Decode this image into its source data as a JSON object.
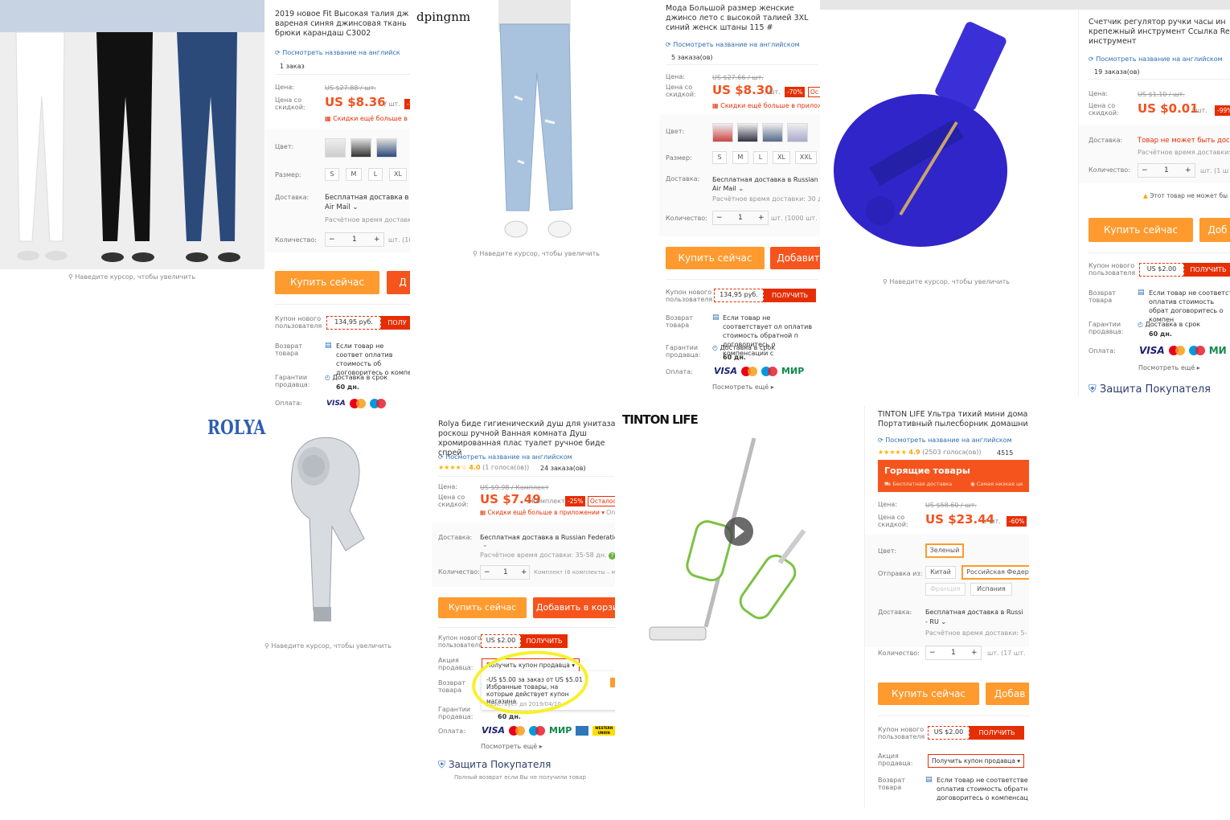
{
  "p1": {
    "title": "2019 новое Fit Высокая талия дж вареная синяя джинсовая ткань брюки карандаш С3002",
    "english_link": "Посмотреть название на английск",
    "orders": "1 заказ",
    "price_label": "Цена:",
    "old_price": "US $27.88 / шт.",
    "discount_label": "Цена со скидкой:",
    "price": "US $8.36",
    "unit": "/ шт.",
    "discount": "-7",
    "app_discount": "Скидки ещё больше в",
    "color_label": "Цвет:",
    "size_label": "Размер:",
    "sizes": [
      "S",
      "M",
      "L",
      "XL"
    ],
    "delivery_label": "Доставка:",
    "delivery": "Бесплатная доставка в I",
    "delivery_method": "Air Mail",
    "delivery_time": "Расчётное время доставк",
    "qty_label": "Количество:",
    "qty": "1",
    "qty_note": "шт. (10",
    "buy": "Купить сейчас",
    "cart": "Д",
    "coupon_label": "Купон нового пользователя",
    "coupon_value": "134,95 руб.",
    "coupon_get": "ПОЛУ",
    "return_label": "Возврат товара",
    "return_text": "Если товар не соответ оплатив стоимость об договоритесь о компе",
    "guarantee_label": "Гарантии продавца:",
    "guarantee_text": "Доставка в срок",
    "guarantee_days": "60 дн.",
    "payment_label": "Оплата:",
    "visa": "VISA",
    "zoom_hint": "Наведите курсор, чтобы увеличить"
  },
  "p2": {
    "brand": "dpingnm",
    "zoom_hint": "Наведите курсор, чтобы увеличить"
  },
  "p3": {
    "title": "Мода Большой размер женские джинсо лето с высокой талией 3XL синий женск штаны 115 #",
    "english_link": "Посмотреть название на английском",
    "orders": "5 заказа(ов)",
    "price_label": "Цена:",
    "old_price": "US $27.66 / шт.",
    "discount_label": "Цена со скидкой:",
    "price": "US $8.30",
    "unit": "/ шт.",
    "discount": "-70%",
    "discount_extra": "Ос",
    "app_discount": "Скидки ещё больше в приложе",
    "color_label": "Цвет:",
    "size_label": "Размер:",
    "sizes": [
      "S",
      "M",
      "L",
      "XL",
      "XXL"
    ],
    "delivery_label": "Доставка:",
    "delivery": "Бесплатная доставка в Russian F",
    "delivery_method": "Air Mail",
    "delivery_time": "Расчётное время доставки: 30 дн",
    "qty_label": "Количество:",
    "qty": "1",
    "qty_note": "шт. (1000 шт. -",
    "buy": "Купить сейчас",
    "cart": "Добавит",
    "coupon_label": "Купон нового пользователя",
    "coupon_value": "134,95 руб.",
    "coupon_get": "ПОЛУЧИТЬ",
    "return_label": "Возврат товара",
    "return_text": "Если товар не соответствует ол оплатив стоимость обратной п договоритесь о компенсации с",
    "guarantee_label": "Гарантии продавца:",
    "guarantee_text": "Доставка в срок",
    "guarantee_days": "60 дн.",
    "payment_label": "Оплата:",
    "visa": "VISA",
    "mir": "МИР",
    "more": "Посмотреть ещё"
  },
  "p4": {
    "title": "Счетчик регулятор ручки часы ин крепежный инструмент Ссылка Re инструмент",
    "english_link": "Посмотреть название на английском",
    "orders": "19 заказа(ов)",
    "price_label": "Цена:",
    "old_price": "US $1.10 / шт.",
    "discount_label": "Цена со скидкой:",
    "price": "US $0.01",
    "unit": "/ шт.",
    "discount": "-99%",
    "delivery_label": "Доставка:",
    "delivery": "Товар не может быть дост",
    "delivery_time": "Расчётное время доставки:",
    "qty_label": "Количество:",
    "qty": "1",
    "qty_note": "шт. (1 ш",
    "warning": "Этот товар не может бы",
    "buy": "Купить сейчас",
    "cart": "Доб",
    "coupon_label": "Купон нового пользователя",
    "coupon_value": "US $2.00",
    "coupon_get": "ПОЛУЧИТЬ",
    "return_label": "Возврат товара",
    "return_text": "Если товар не соответст оплатив стоимость обрат договоритесь о компен",
    "guarantee_label": "Гарантии продавца:",
    "guarantee_text": "Доставка в срок",
    "guarantee_days": "60 дн.",
    "payment_label": "Оплата:",
    "visa": "VISA",
    "mir": "МИ",
    "more": "Посмотреть ещё",
    "protection": "Защита Покупателя",
    "zoom_hint": "Наведите курсор, чтобы увеличить"
  },
  "p5": {
    "brand": "ROLYA",
    "zoom_hint": "Наведите курсор, чтобы увеличить",
    "title": "Rolya биде гигиенический душ для унитаза роскош ручной Ванная комната Душ хромированная плас туалет ручное биде спрей",
    "english_link": "Посмотреть название на английском",
    "rating": "4.0",
    "votes": "(1 голоса(ов))",
    "orders": "24 заказа(ов)",
    "price_label": "Цена:",
    "old_price": "US $9.98 / Комплект",
    "discount_label": "Цена со скидкой:",
    "price": "US $7.49",
    "unit": "/ Комплект",
    "discount": "-25%",
    "discount_extra": "Осталось",
    "app_discount": "Скидки ещё больше в приложении",
    "on": "On",
    "delivery_label": "Доставка:",
    "delivery": "Бесплатная доставка в Russian Federation сл",
    "delivery_time": "Расчётное время доставки: 35-58 дн.",
    "qty_label": "Количество:",
    "qty": "1",
    "qty_note": "Комплект (6 комплекты – мак",
    "buy": "Купить сейчас",
    "cart": "Добавить в корзи",
    "coupon_label": "Купон нового пользователя",
    "coupon_value": "US $2.00",
    "coupon_get": "ПОЛУЧИТЬ",
    "promo_label": "Акция продавца:",
    "promo_dropdown": "Получить купон продавца",
    "promo_text": "-US $5.00 за заказ от US $5.01",
    "promo_desc": "Избранные товары, на которые действует купон магазина",
    "promo_valid": "Действует до 2019/04/10",
    "return_label": "Возврат товара",
    "guarantee_label": "Гарантии продавца:",
    "guarantee_days": "60 дн.",
    "payment_label": "Оплата:",
    "visa": "VISA",
    "mir": "МИР",
    "wu": "WESTERN UNION",
    "more": "Посмотреть ещё",
    "protection": "Защита Покупателя",
    "protection_sub": "Полный возврат если Вы не получили товар"
  },
  "p6": {
    "brand": "TINTON LIFE",
    "title": "TINTON LIFE Ультра тихий мини дома Портативный пылесборник домашни",
    "english_link": "Посмотреть название на английском",
    "rating": "4.9",
    "votes": "(2503 голоса(ов))",
    "orders": "4515",
    "hot_title": "Горящие товары",
    "hot_left": "Бесплатная доставка",
    "hot_right": "Самая низкая це",
    "price_label": "Цена:",
    "old_price": "US $58.60 / шт.",
    "discount_label": "Цена со скидкой:",
    "price": "US $23.44",
    "unit": "/ шт.",
    "discount": "-60%",
    "color_label": "Цвет:",
    "color_value": "Зеленый",
    "ship_from_label": "Отправка из:",
    "ship_from": [
      "Китай",
      "Российская Федер",
      "Франция",
      "Испания"
    ],
    "delivery_label": "Доставка:",
    "delivery": "Бесплатная доставка в Russi",
    "delivery_ru": "- RU",
    "delivery_time": "Расчётное время доставки: 5-",
    "qty_label": "Количество:",
    "qty": "1",
    "qty_note": "шт. (17 шт.",
    "buy": "Купить сейчас",
    "cart": "Добав",
    "coupon_label": "Купон нового пользователя",
    "coupon_value": "US $2.00",
    "coupon_get": "ПОЛУЧИТЬ",
    "promo_label": "Акция продавца:",
    "promo_dropdown": "Получить купон продавца",
    "return_label": "Возврат товара",
    "return_text": "Если товар не соответстве оплатив стоимость обратн договоритесь о компенсац"
  },
  "colors": {
    "orange": "#ff9a2e",
    "red": "#e62e04",
    "link": "#2e6fb5",
    "highlight": "#f7f02a"
  }
}
